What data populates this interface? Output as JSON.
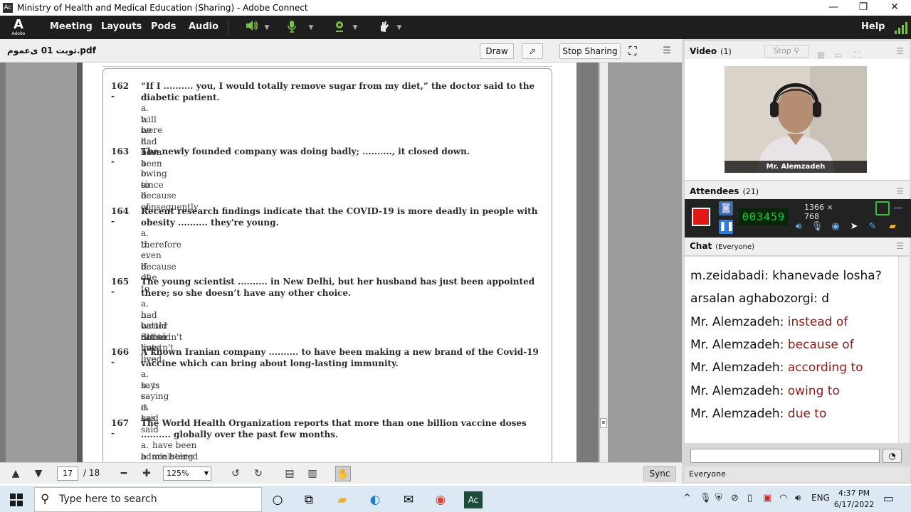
{
  "window": {
    "title": "Ministry of Health and Medical Education (Sharing) - Adobe Connect",
    "app_icon": "Ac",
    "minimize": "—",
    "restore": "❐",
    "close": "✕"
  },
  "menubar": {
    "logo": "A",
    "logo_sub": "Adobe",
    "items": [
      "Meeting",
      "Layouts",
      "Pods",
      "Audio"
    ],
    "help": "Help",
    "speaker_icon": "speaker-icon",
    "mic_icon": "microphone-icon",
    "camera_icon": "webcam-icon",
    "status_icon": "raise-hand-icon",
    "colors": {
      "speaker": "#7cc242",
      "mic": "#7cc242",
      "cam": "#7cc242",
      "signal": "#7cc242"
    }
  },
  "share": {
    "file_name": "توبت 01 ی‌عموم.pdf",
    "draw_label": "Draw",
    "stop_label": "Stop Sharing",
    "footer": {
      "current_page": "17",
      "total_pages": "/ 18",
      "zoom": "125%",
      "sync_label": "Sync"
    },
    "questions": [
      {
        "num": "162 -",
        "stem": "“If I .......... you, I would totally remove sugar from my diet,” the doctor said to the diabetic patient.",
        "options": [
          {
            "l": "a.",
            "t": "will be"
          },
          {
            "l": "b.",
            "t": "were"
          },
          {
            "l": "c.",
            "t": "had been"
          },
          {
            "l": "d.",
            "t": "have been"
          }
        ]
      },
      {
        "num": "163 -",
        "stem": "The newly founded company was doing badly; .........., it closed down.",
        "options": [
          {
            "l": "a.",
            "t": "owing to"
          },
          {
            "l": "b.",
            "t": "since"
          },
          {
            "l": "c.",
            "t": "because of"
          },
          {
            "l": "d.",
            "t": "consequently"
          }
        ]
      },
      {
        "num": "164 -",
        "stem": "Recent research findings indicate that the COVID-19 is more deadly in people with obesity .......... they're young.",
        "options": [
          {
            "l": "a.",
            "t": "therefore"
          },
          {
            "l": "b.",
            "t": "even if"
          },
          {
            "l": "c.",
            "t": "because of"
          },
          {
            "l": "d.",
            "t": "due to"
          }
        ]
      },
      {
        "num": "165 -",
        "stem": "The young scientist .......... in New Delhi, but her husband has just been appointed there; so she doesn’t have any other choice.",
        "options": [
          {
            "l": "a.",
            "t": "had better not to live"
          },
          {
            "l": "b.",
            "t": "would rather not live"
          },
          {
            "l": "c.",
            "t": "Shouldn't have lived"
          },
          {
            "l": "d.",
            "t": "mustn't live"
          }
        ]
      },
      {
        "num": "166 -",
        "stem": "A known Iranian company .......... to have been making a new brand of the Covid-19 vaccine which can bring about long-lasting immunity.",
        "options": [
          {
            "l": "a.",
            "t": "says"
          },
          {
            "l": "b.",
            "t": "is saying"
          },
          {
            "l": "c.",
            "t": "is said"
          },
          {
            "l": "d.",
            "t": "has said"
          }
        ]
      },
      {
        "num": "167 -",
        "stem": "The World Health Organization reports that more than one billion vaccine doses .......... globally over the past few months.",
        "options": [
          {
            "l": "a.",
            "t": "have been administered"
          },
          {
            "l": "b.",
            "t": "are being administered"
          }
        ]
      }
    ]
  },
  "video": {
    "title": "Video",
    "count": "(1)",
    "stop_label": "Stop",
    "participant": "Mr. Alemzadeh"
  },
  "attendees": {
    "title": "Attendees",
    "count": "(21)"
  },
  "recorder": {
    "timer": "003459",
    "resolution": "1366 × 768"
  },
  "chat": {
    "title": "Chat",
    "scope": "(Everyone)",
    "messages": [
      {
        "who": "m.zeidabadi:",
        "text": "khanevade losha?"
      },
      {
        "who": "arsalan aghabozorgi:",
        "text": "d"
      },
      {
        "who": "Mr. Alemzadeh:",
        "text": "instead of"
      },
      {
        "who": "Mr. Alemzadeh:",
        "text": "because of"
      },
      {
        "who": "Mr. Alemzadeh:",
        "text": "according to"
      },
      {
        "who": "Mr. Alemzadeh:",
        "text": "owing to"
      },
      {
        "who": "Mr. Alemzadeh:",
        "text": "due to"
      }
    ],
    "target": "Everyone"
  },
  "taskbar": {
    "search_placeholder": "Type here to search",
    "lang": "ENG",
    "time": "4:37 PM",
    "date": "6/17/2022"
  }
}
